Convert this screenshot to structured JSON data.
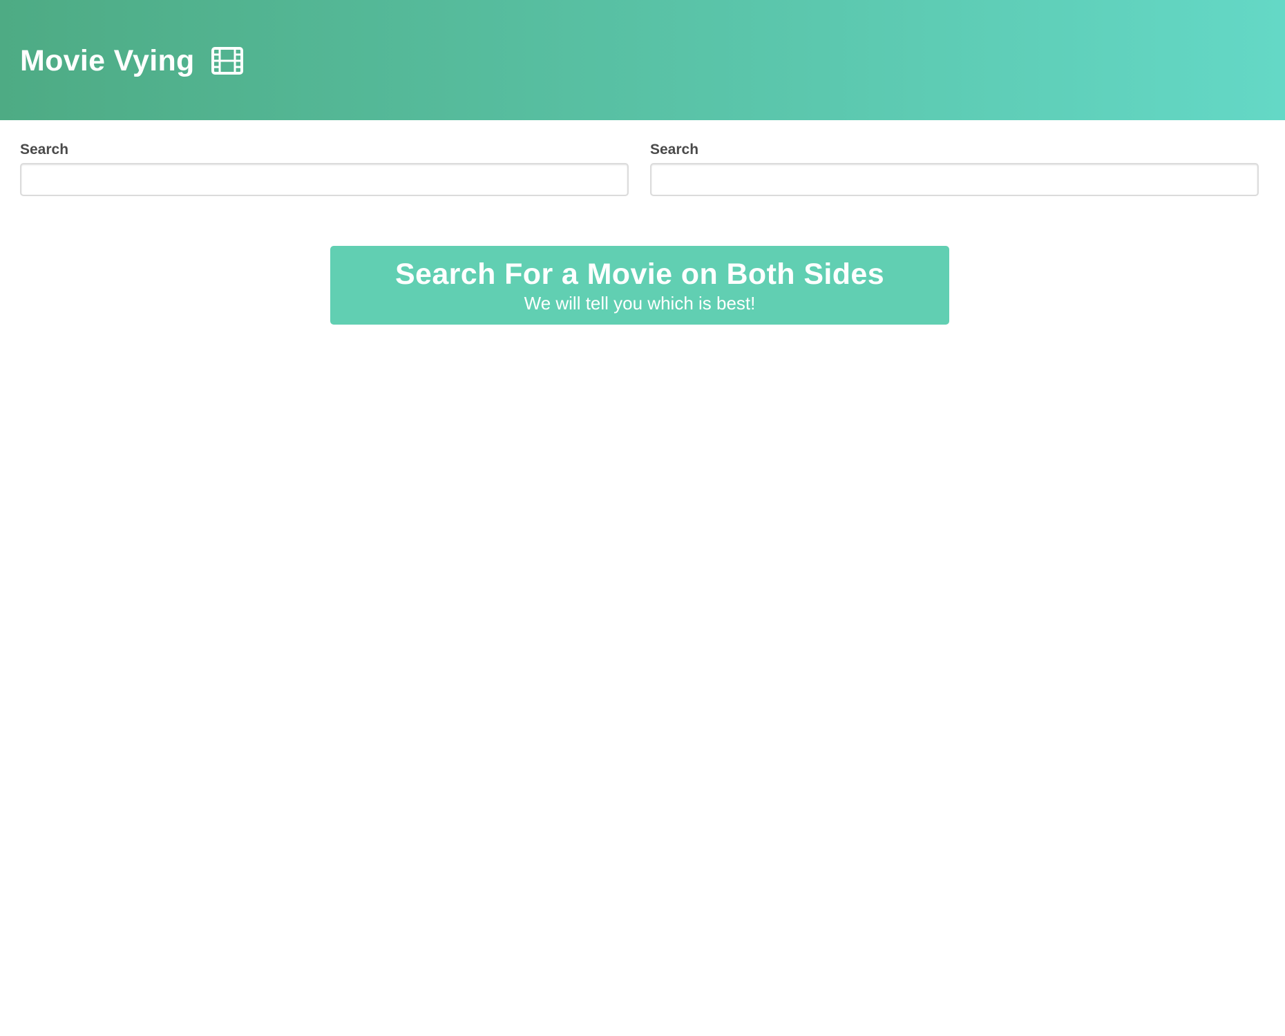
{
  "header": {
    "title": "Movie Vying",
    "icon": "film-icon",
    "gradient_start": "#4eab84",
    "gradient_end": "#64d8c6"
  },
  "search_left": {
    "label": "Search",
    "value": "",
    "placeholder": ""
  },
  "search_right": {
    "label": "Search",
    "value": "",
    "placeholder": ""
  },
  "prompt": {
    "title": "Search For a Movie on Both Sides",
    "subtitle": "We will tell you which is best!",
    "background": "#61cfb2"
  }
}
